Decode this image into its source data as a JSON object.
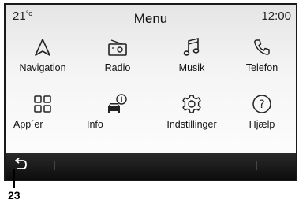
{
  "status": {
    "temperature": "21",
    "temperature_unit": "°c",
    "title": "Menu",
    "time": "12:00"
  },
  "menu": {
    "items": [
      {
        "label": "Navigation",
        "icon": "navigation-arrow-icon"
      },
      {
        "label": "Radio",
        "icon": "radio-icon"
      },
      {
        "label": "Musik",
        "icon": "music-note-icon"
      },
      {
        "label": "Telefon",
        "icon": "phone-icon"
      },
      {
        "label": "App´er",
        "icon": "apps-grid-icon"
      },
      {
        "label": "Info",
        "icon": "info-car-icon"
      },
      {
        "label": "Indstillinger",
        "icon": "settings-gear-icon"
      },
      {
        "label": "Hjælp",
        "icon": "help-icon"
      }
    ]
  },
  "bottom_bar": {
    "back_icon": "back-arrow-icon"
  },
  "callout": {
    "number": "23"
  }
}
